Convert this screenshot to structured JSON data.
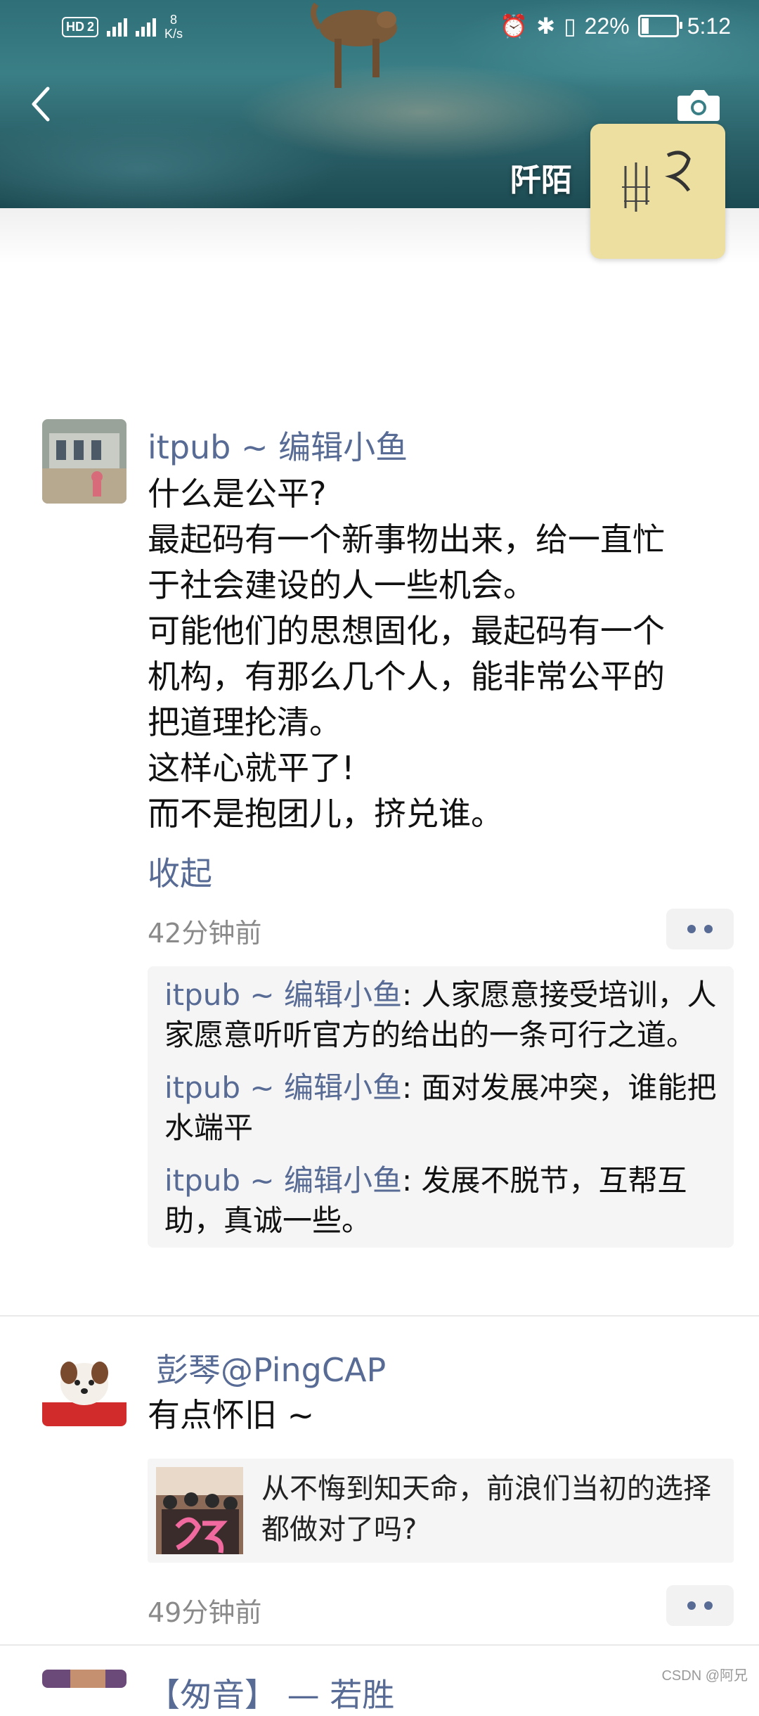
{
  "status_bar": {
    "hd_label": "HD",
    "sim_label": "2",
    "net_speed_value": "8",
    "net_speed_unit": "K/s",
    "battery": "22%",
    "battery_level": 0.22,
    "time": "5:12"
  },
  "profile": {
    "name": "阡陌"
  },
  "posts": [
    {
      "author": "itpub ~ 编辑小鱼",
      "lines": [
        "什么是公平?",
        "最起码有一个新事物出来，给一直忙",
        "于社会建设的人一些机会。",
        "可能他们的思想固化，最起码有一个",
        "机构，有那么几个人，能非常公平的",
        "把道理抡清。",
        "这样心就平了!",
        "而不是抱团儿，挤兑谁。"
      ],
      "collapse_label": "收起",
      "time": "42分钟前",
      "comments": [
        {
          "author": "itpub ~ 编辑小鱼",
          "sep": ": ",
          "text": "人家愿意接受培训，人家愿意听听官方的给出的一条可行之道。"
        },
        {
          "author": "itpub ~ 编辑小鱼",
          "sep": ": ",
          "text": "面对发展冲突，谁能把水端平"
        },
        {
          "author": "itpub ~ 编辑小鱼",
          "sep": ": ",
          "text": "发展不脱节，互帮互助，真诚一些。"
        }
      ]
    },
    {
      "author": "彭琴@PingCAP",
      "text": "有点怀旧 ~",
      "link_title": "从不悔到知天命，前浪们当初的选择都做对了吗?",
      "time": "49分钟前"
    },
    {
      "author": "【匆音】 — 若胜"
    }
  ],
  "watermark": "CSDN @阿兄",
  "colors": {
    "link_blue": "#576b95",
    "comment_bg": "#f5f5f5",
    "text_main": "#111111",
    "time_gray": "#8a8a8a"
  }
}
